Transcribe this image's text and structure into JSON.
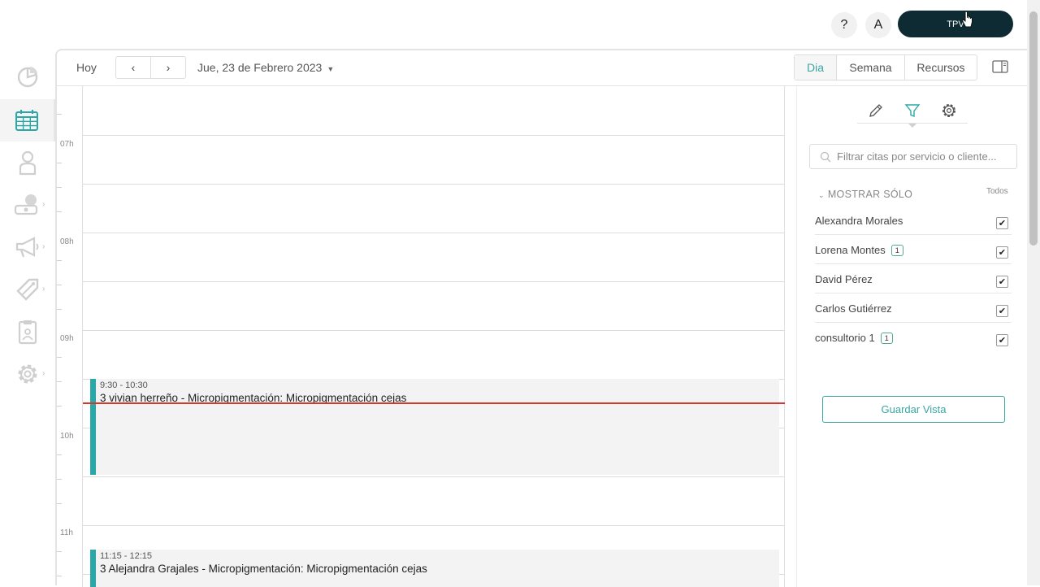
{
  "topbar": {
    "help_label": "?",
    "avatar_label": "A",
    "tpv_label": "TPV"
  },
  "sidebar": {
    "items": [
      {
        "icon": "dashboard-icon"
      },
      {
        "icon": "calendar-icon",
        "active": true
      },
      {
        "icon": "clients-icon"
      },
      {
        "icon": "sales-icon"
      },
      {
        "icon": "marketing-icon"
      },
      {
        "icon": "products-icon"
      },
      {
        "icon": "reports-icon"
      },
      {
        "icon": "settings-icon"
      }
    ]
  },
  "toolbar": {
    "today_label": "Hoy",
    "prev_label": "‹",
    "next_label": "›",
    "date_label": "Jue, 23 de Febrero 2023",
    "views": [
      "Dia",
      "Semana",
      "Recursos"
    ],
    "active_view": "Dia"
  },
  "calendar": {
    "hours": [
      "07h",
      "08h",
      "09h",
      "10h",
      "11h"
    ],
    "events": [
      {
        "time": "9:30 - 10:30",
        "title": "3 vivian herreño - Micropigmentación: Micropigmentación cejas"
      },
      {
        "time": "11:15 - 12:15",
        "title": "3 Alejandra Grajales - Micropigmentación: Micropigmentación cejas"
      }
    ],
    "accent_color": "#2aa8a8",
    "now_line_color": "#d9362b"
  },
  "panel": {
    "search_placeholder": "Filtrar citas por servicio o cliente...",
    "show_only_label": "MOSTRAR SÓLO",
    "all_label": "Todos",
    "staff": [
      {
        "name": "Alexandra Morales",
        "badge": "",
        "checked": true
      },
      {
        "name": "Lorena Montes",
        "badge": "1",
        "checked": true
      },
      {
        "name": "David Pérez",
        "badge": "",
        "checked": true
      },
      {
        "name": "Carlos Gutiérrez",
        "badge": "",
        "checked": true
      },
      {
        "name": "consultorio 1",
        "badge": "1",
        "checked": true
      }
    ],
    "save_view_label": "Guardar Vista",
    "active_tab": "filter"
  }
}
